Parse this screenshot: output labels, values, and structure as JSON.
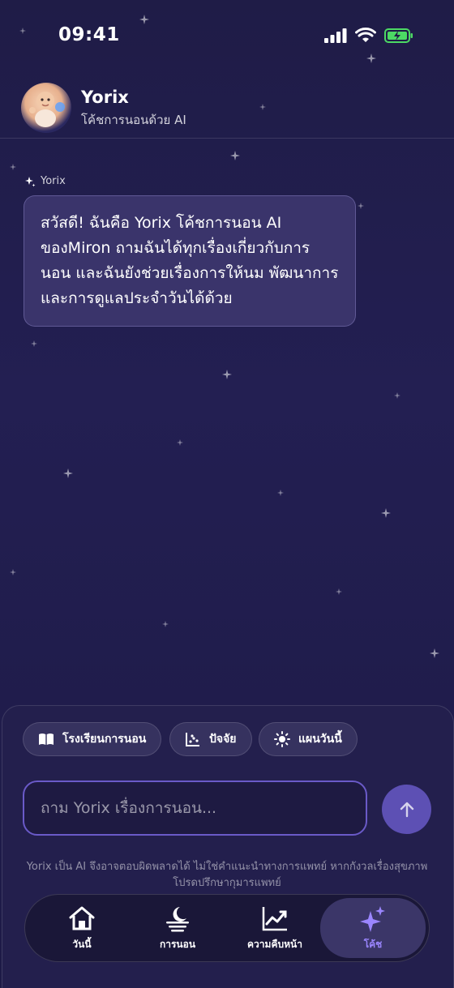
{
  "status": {
    "time": "09:41"
  },
  "header": {
    "title": "Yorix",
    "subtitle": "โค้ชการนอนด้วย AI"
  },
  "chat": {
    "sender": "Yorix",
    "message": "สวัสดี! ฉันคือ Yorix โค้ชการนอน AI ของMiron ถามฉันได้ทุกเรื่องเกี่ยวกับการนอน และฉันยังช่วยเรื่องการให้นม พัฒนาการ และการดูแลประจำวันได้ด้วย"
  },
  "chips": [
    {
      "label": "โรงเรียนการนอน",
      "icon": "book-icon"
    },
    {
      "label": "ปัจจัย",
      "icon": "scatter-icon"
    },
    {
      "label": "แผนวันนี้",
      "icon": "sun-icon"
    }
  ],
  "composer": {
    "placeholder": "ถาม Yorix เรื่องการนอน...",
    "value": ""
  },
  "disclaimer": "Yorix เป็น AI จึงอาจตอบผิดพลาดได้ ไม่ใช่คำแนะนำทางการแพทย์ หากกังวลเรื่องสุขภาพ โปรดปรึกษากุมารแพทย์",
  "tabs": [
    {
      "label": "วันนี้",
      "icon": "home-icon"
    },
    {
      "label": "การนอน",
      "icon": "moon-icon"
    },
    {
      "label": "ความคืบหน้า",
      "icon": "trend-icon"
    },
    {
      "label": "โค้ช",
      "icon": "sparkle-icon",
      "active": true
    }
  ],
  "colors": {
    "background": "#221e4e",
    "accent": "#9b86ff",
    "bubble": "#3a346b",
    "battery": "#4cd964"
  }
}
